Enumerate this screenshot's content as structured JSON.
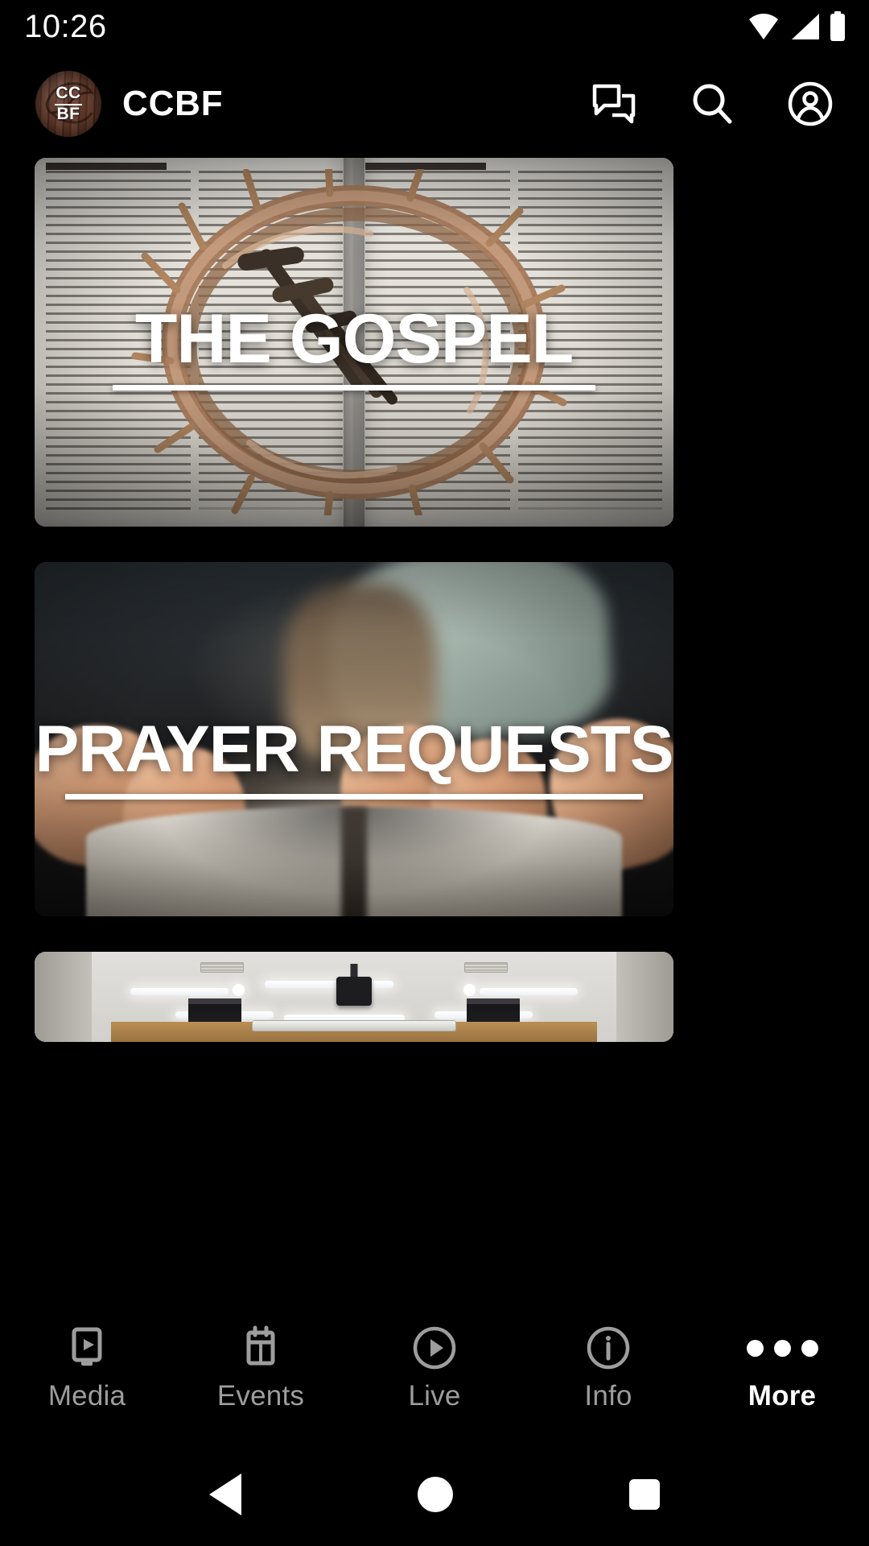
{
  "status_bar": {
    "time": "10:26",
    "icons": [
      "wifi-icon",
      "cellular-signal-icon",
      "battery-icon"
    ]
  },
  "app_bar": {
    "logo_alt": "ccbf-logo",
    "logo_monogram_top": "CC",
    "logo_monogram_bottom": "BF",
    "title": "CCBF",
    "actions": [
      {
        "name": "chat-icon",
        "label": "Chat"
      },
      {
        "name": "search-icon",
        "label": "Search"
      },
      {
        "name": "account-icon",
        "label": "Account"
      }
    ]
  },
  "cards": [
    {
      "id": "gospel",
      "title": "THE GOSPEL",
      "image_alt": "open-bible-with-crown-of-thorns-and-nails"
    },
    {
      "id": "prayer-requests",
      "title": "PRAYER REQUESTS",
      "image_alt": "praying-hands-over-open-bible"
    },
    {
      "id": "room",
      "title": "",
      "image_alt": "church-meeting-room-interior-ceiling"
    }
  ],
  "bottom_nav": {
    "items": [
      {
        "label": "Media",
        "icon": "media-screen-play-icon",
        "active": false
      },
      {
        "label": "Events",
        "icon": "calendar-icon",
        "active": false
      },
      {
        "label": "Live",
        "icon": "play-circle-icon",
        "active": false
      },
      {
        "label": "Info",
        "icon": "info-circle-icon",
        "active": false
      },
      {
        "label": "More",
        "icon": "more-dots-icon",
        "active": true
      }
    ],
    "inactive_color": "#9d9d9d",
    "active_color": "#ffffff"
  },
  "system_nav": {
    "back": "back-triangle-icon",
    "home": "home-circle-icon",
    "recents": "recents-square-icon"
  },
  "theme": {
    "background": "#000000",
    "text": "#ffffff"
  }
}
